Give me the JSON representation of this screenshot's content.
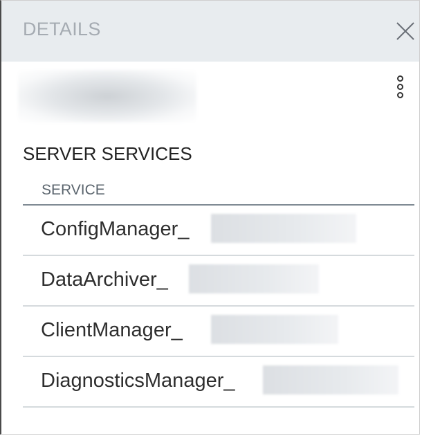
{
  "header": {
    "title": "DETAILS",
    "close_icon": "close-icon"
  },
  "subheader": {
    "menu_icon": "more-vertical-icon"
  },
  "section": {
    "title": "SERVER SERVICES"
  },
  "table": {
    "column_header": "SERVICE",
    "rows": [
      {
        "label": "ConfigManager_"
      },
      {
        "label": "DataArchiver_"
      },
      {
        "label": "ClientManager_"
      },
      {
        "label": "DiagnosticsManager_"
      }
    ]
  }
}
